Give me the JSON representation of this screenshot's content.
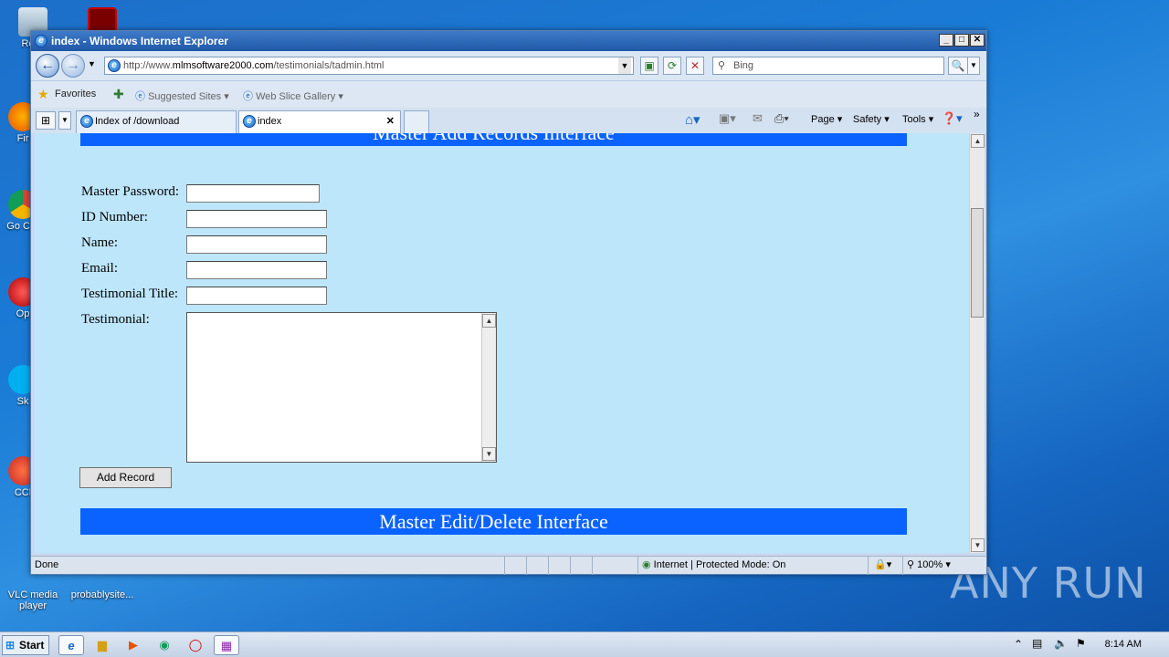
{
  "desktop": {
    "icons": [
      {
        "label": "Recy"
      },
      {
        "label": "Fir"
      },
      {
        "label": "Go Chr"
      },
      {
        "label": "Op"
      },
      {
        "label": "Sk"
      },
      {
        "label": "CCl"
      },
      {
        "label": "VLC media player"
      },
      {
        "label": "probablysite..."
      }
    ],
    "watermark": "ANY RUN"
  },
  "window": {
    "title": "index - Windows Internet Explorer",
    "url_prefix": "http://www.",
    "url_host": "mlmsoftware2000.com",
    "url_path": "/testimonials/tadmin.html",
    "search_placeholder": "Bing",
    "favorites_label": "Favorites",
    "fav_items": [
      "Suggested Sites",
      "Web Slice Gallery"
    ],
    "tabs": [
      {
        "label": "Index of /download"
      },
      {
        "label": "index"
      }
    ],
    "commands": [
      "Page",
      "Safety",
      "Tools"
    ],
    "status": {
      "left": "Done",
      "zone": "Internet | Protected Mode: On",
      "zoom": "100%"
    }
  },
  "form": {
    "top_banner": "Master Add Records Interface",
    "labels": {
      "password": "Master Password:",
      "id": "ID Number:",
      "name": "Name:",
      "email": "Email:",
      "title": "Testimonial Title:",
      "testimonial": "Testimonial:"
    },
    "add_button": "Add Record",
    "bottom_banner": "Master Edit/Delete Interface"
  },
  "taskbar": {
    "start_label": "Start",
    "clock": "8:14 AM"
  }
}
